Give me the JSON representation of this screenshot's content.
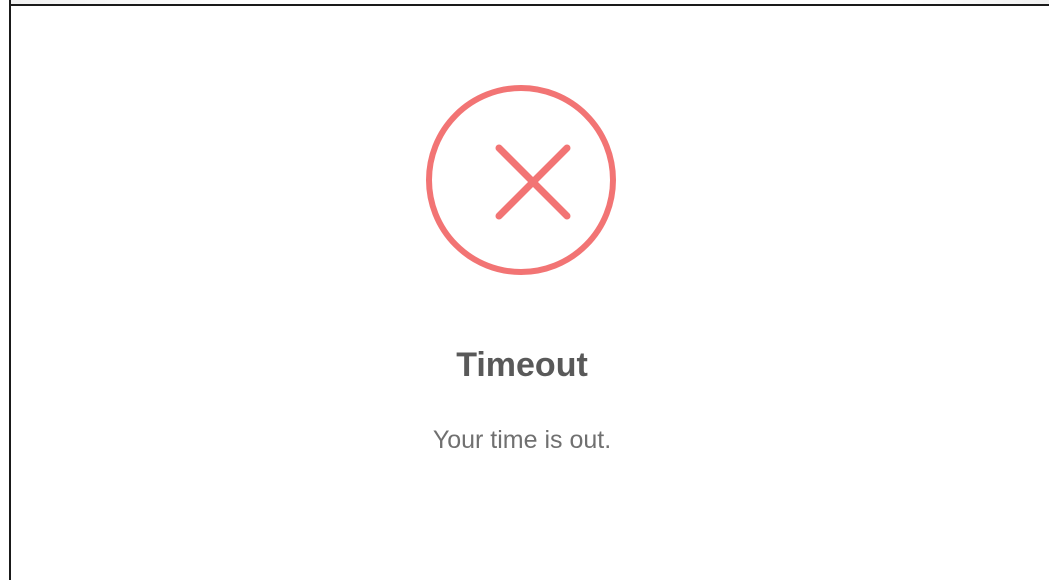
{
  "dialog": {
    "icon": "error-x-icon",
    "title": "Timeout",
    "message": "Your time is out."
  },
  "colors": {
    "error_accent": "#f27474",
    "title_text": "#595959",
    "message_text": "#707070",
    "background": "#ffffff"
  }
}
